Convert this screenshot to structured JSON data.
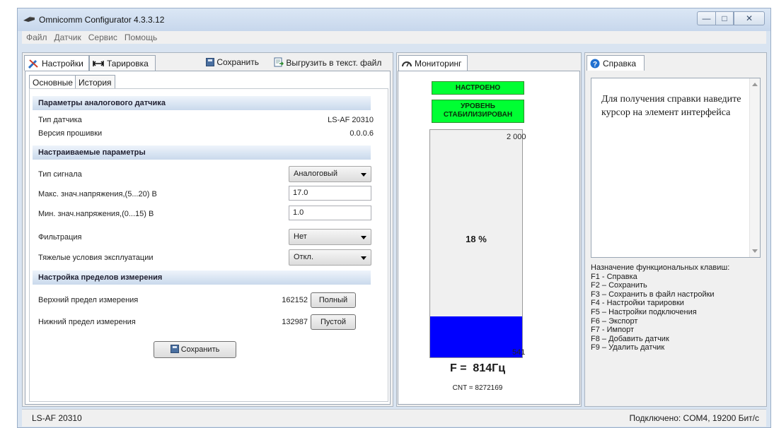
{
  "window": {
    "title": "Omnicomm Configurator 4.3.3.12",
    "buttons": {
      "minimize": "—",
      "maximize": "□",
      "close": "✕"
    }
  },
  "menu": [
    "Файл",
    "Датчик",
    "Сервис",
    "Помощь"
  ],
  "left_panel": {
    "tabs": [
      "Настройки",
      "Тарировка"
    ],
    "toolbar": {
      "save": "Сохранить",
      "export": "Выгрузить в текст. файл"
    },
    "subtabs": [
      "Основные",
      "История"
    ],
    "sections": {
      "analog": "Параметры аналогового датчика",
      "tunable": "Настраиваемые параметры",
      "limits": "Настройка пределов измерения"
    },
    "sensor_type": {
      "label": "Тип датчика",
      "value": "LS-AF 20310"
    },
    "firmware": {
      "label": "Версия прошивки",
      "value": "0.0.0.6"
    },
    "signal_type": {
      "label": "Тип сигнала",
      "value": "Аналоговый"
    },
    "max_voltage": {
      "label": "Макс. знач.напряжения,(5...20) В",
      "value": "17.0"
    },
    "min_voltage": {
      "label": "Мин. знач.напряжения,(0...15) В",
      "value": "1.0"
    },
    "filtration": {
      "label": "Фильтрация",
      "value": "Нет"
    },
    "heavy_conditions": {
      "label": "Тяжелые условия эксплуатации",
      "value": "Откл."
    },
    "upper_limit": {
      "label": "Верхний предел измерения",
      "value": "162152",
      "button": "Полный"
    },
    "lower_limit": {
      "label": "Нижний предел измерения",
      "value": "132987",
      "button": "Пустой"
    },
    "save_button": "Сохранить"
  },
  "monitor": {
    "tab": "Мониторинг",
    "status_tuned": "НАСТРОЕНО",
    "status_level_1": "УРОВЕНЬ",
    "status_level_2": "СТАБИЛИЗИРОВАН",
    "scale_max": "2 000",
    "scale_min": "541",
    "percent_label": "18 %",
    "level_fraction": 0.18,
    "frequency": "F =  814Гц",
    "cnt": "CNT = 8272169"
  },
  "help": {
    "tab": "Справка",
    "text": "Для получения справки наведите курсор на элемент интерфейса",
    "keys_title": "Назначение функциональных клавиш:",
    "keys": [
      "F1 - Справка",
      "F2 – Сохранить",
      "F3 – Сохранить в файл настройки",
      "F4 - Настройки тарировки",
      "F5 – Настройки подключения",
      "F6 – Экспорт",
      "F7 - Импорт",
      "F8 – Добавить датчик",
      "F9 – Удалить датчик"
    ]
  },
  "statusbar": {
    "left": "LS-AF 20310",
    "right": "Подключено: COM4, 19200 Бит/с"
  },
  "colors": {
    "level_bar": "#0000ff",
    "status_green": "#00ff33"
  }
}
